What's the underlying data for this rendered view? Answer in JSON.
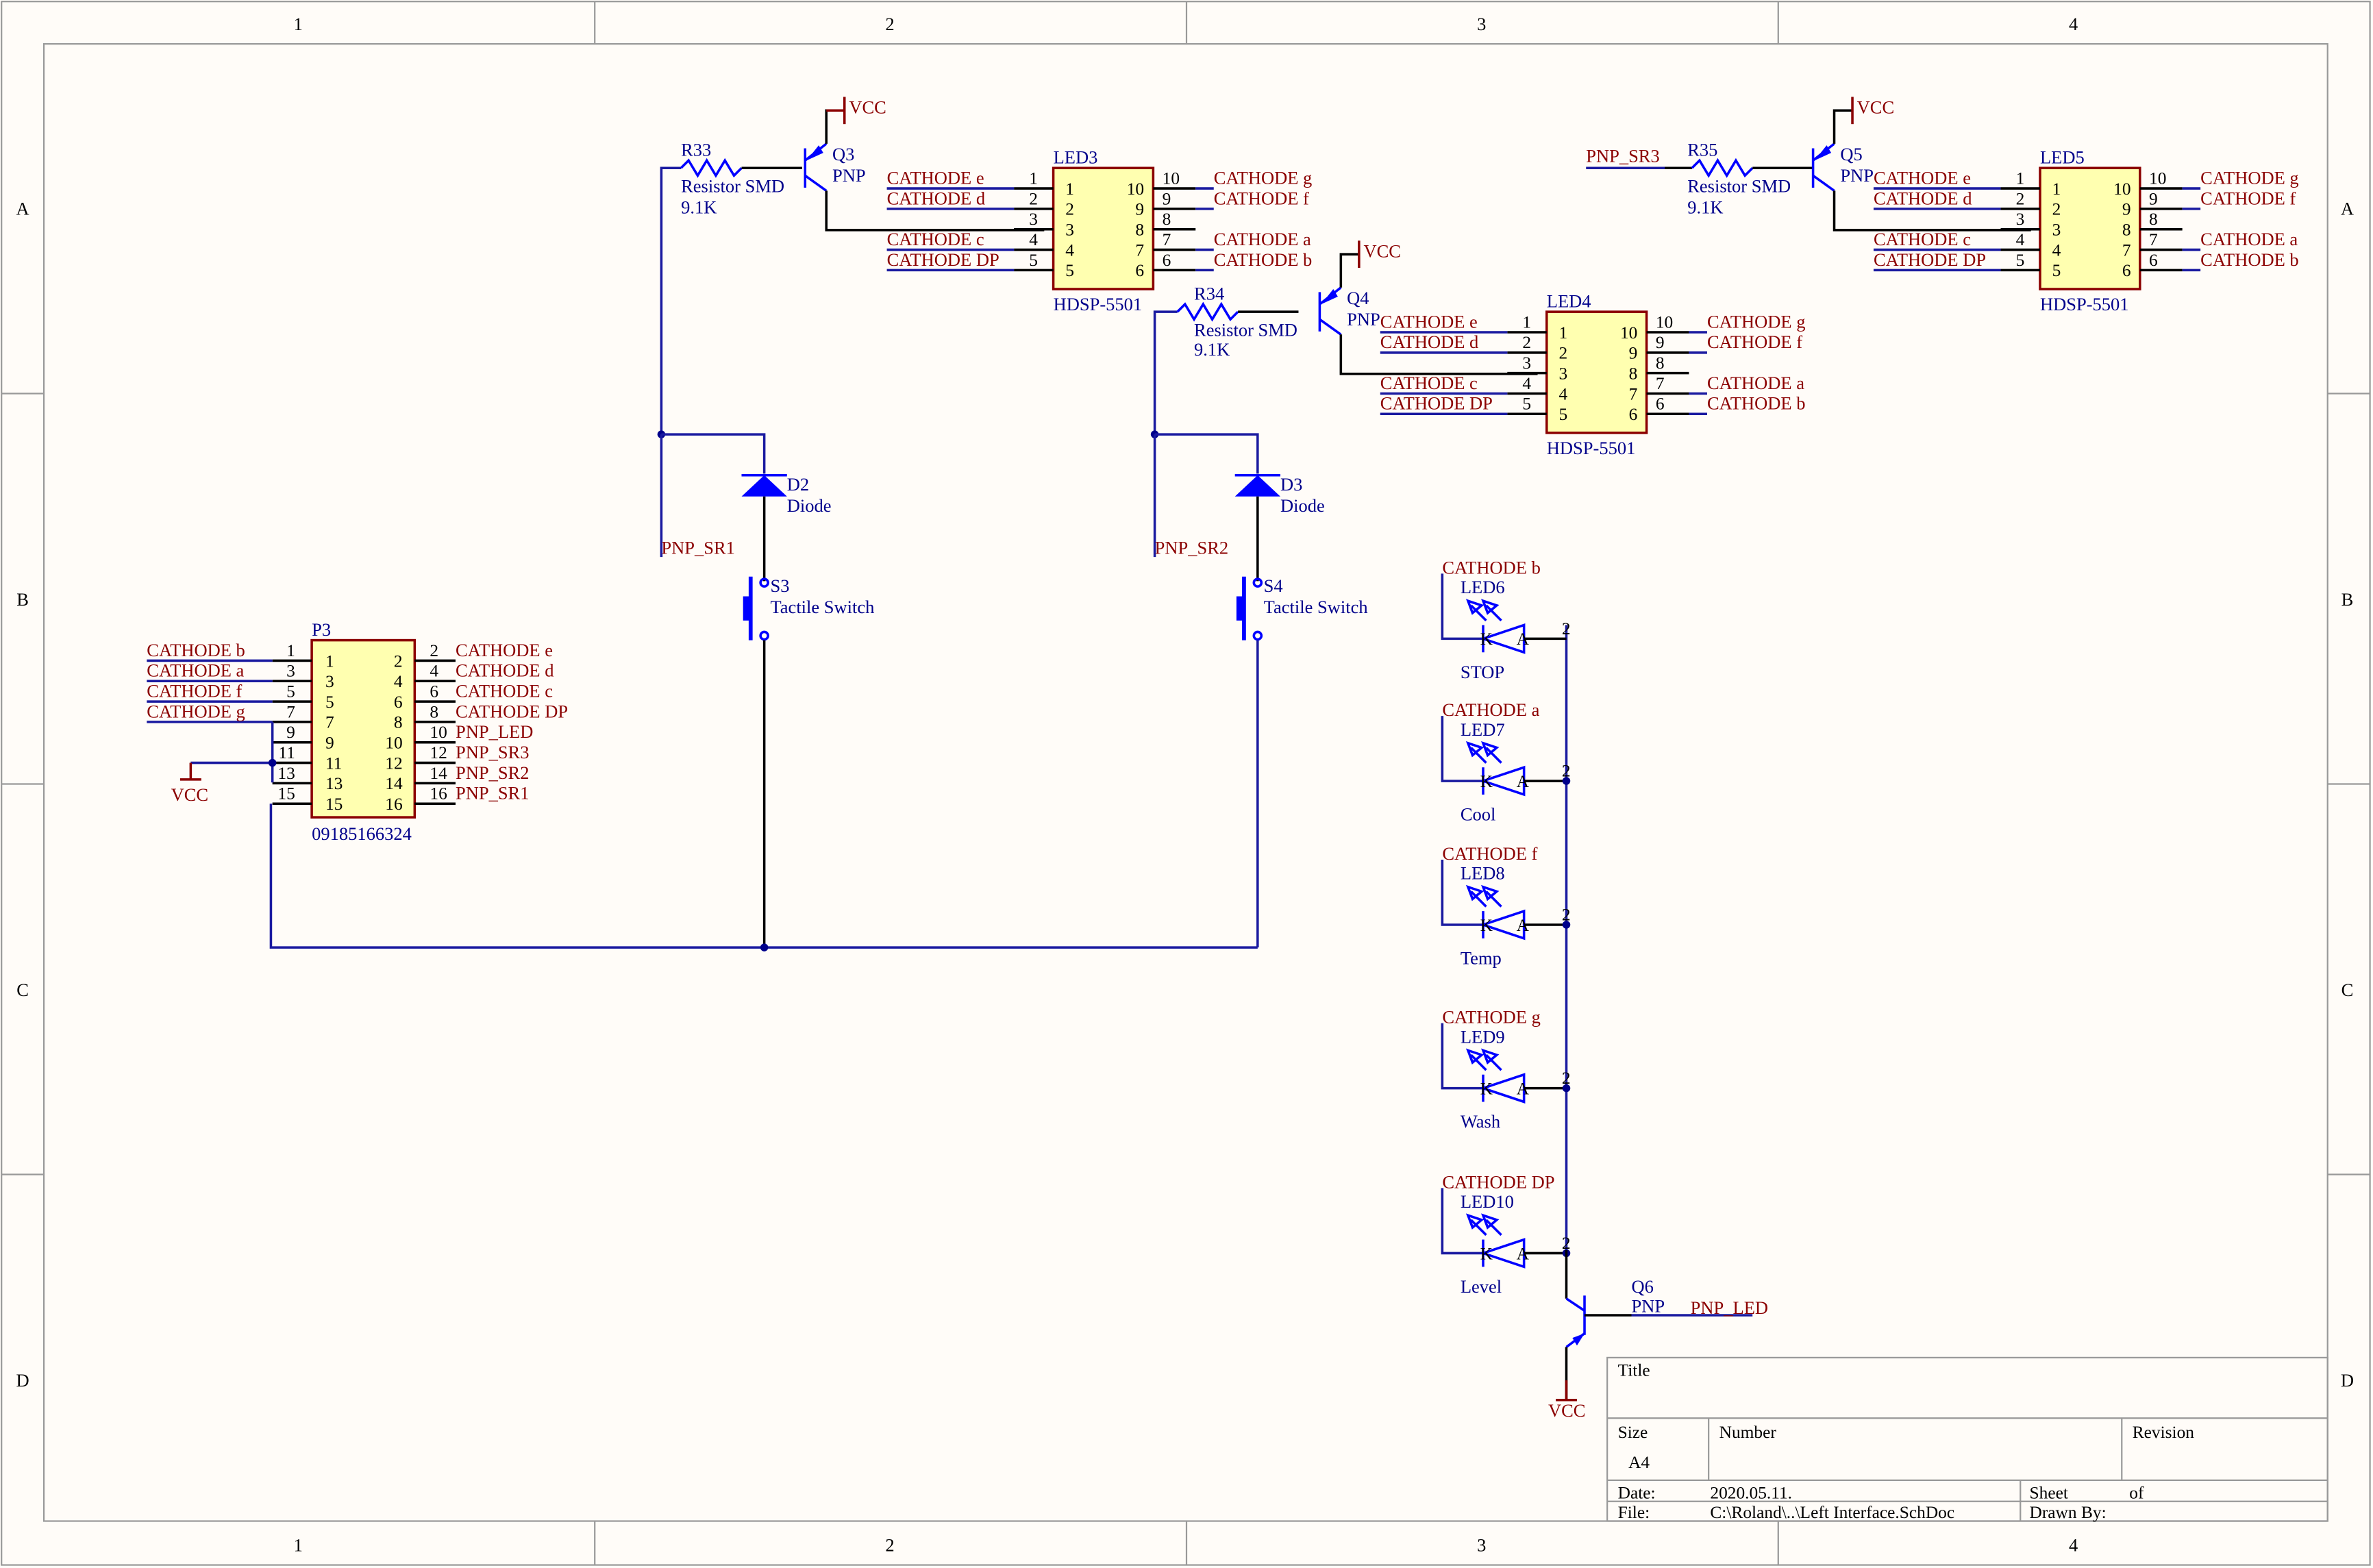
{
  "frame": {
    "columns": [
      "1",
      "2",
      "3",
      "4"
    ],
    "rows": [
      "A",
      "B",
      "C",
      "D"
    ]
  },
  "components": {
    "q3": {
      "ref": "Q3",
      "type": "PNP"
    },
    "q4": {
      "ref": "Q4",
      "type": "PNP"
    },
    "q5": {
      "ref": "Q5",
      "type": "PNP"
    },
    "q6": {
      "ref": "Q6",
      "type": "PNP"
    },
    "r33": {
      "ref": "R33",
      "type": "Resistor SMD",
      "value": "9.1K"
    },
    "r34": {
      "ref": "R34",
      "type": "Resistor SMD",
      "value": "9.1K"
    },
    "r35": {
      "ref": "R35",
      "type": "Resistor SMD",
      "value": "9.1K"
    },
    "d2": {
      "ref": "D2",
      "type": "Diode"
    },
    "d3": {
      "ref": "D3",
      "type": "Diode"
    },
    "s3": {
      "ref": "S3",
      "type": "Tactile Switch"
    },
    "s4": {
      "ref": "S4",
      "type": "Tactile Switch"
    },
    "led3": {
      "ref": "LED3",
      "part": "HDSP-5501"
    },
    "led4": {
      "ref": "LED4",
      "part": "HDSP-5501"
    },
    "led5": {
      "ref": "LED5",
      "part": "HDSP-5501"
    },
    "p3": {
      "ref": "P3",
      "part": "09185166324"
    },
    "indicators": [
      {
        "ref": "LED6",
        "net": "CATHODE b",
        "label": "STOP"
      },
      {
        "ref": "LED7",
        "net": "CATHODE a",
        "label": "Cool"
      },
      {
        "ref": "LED8",
        "net": "CATHODE f",
        "label": "Temp"
      },
      {
        "ref": "LED9",
        "net": "CATHODE g",
        "label": "Wash"
      },
      {
        "ref": "LED10",
        "net": "CATHODE DP",
        "label": "Level"
      }
    ]
  },
  "seg_display": {
    "left_pins": [
      {
        "num": "1",
        "net": "CATHODE e"
      },
      {
        "num": "2",
        "net": "CATHODE d"
      },
      {
        "num": "3",
        "net": ""
      },
      {
        "num": "4",
        "net": "CATHODE c"
      },
      {
        "num": "5",
        "net": "CATHODE DP"
      }
    ],
    "right_pins": [
      {
        "num": "10",
        "net": "CATHODE g"
      },
      {
        "num": "9",
        "net": "CATHODE f"
      },
      {
        "num": "8",
        "net": ""
      },
      {
        "num": "7",
        "net": "CATHODE a"
      },
      {
        "num": "6",
        "net": "CATHODE b"
      }
    ]
  },
  "p3_pins": {
    "left": [
      {
        "num": "1",
        "net": "CATHODE b"
      },
      {
        "num": "3",
        "net": "CATHODE a"
      },
      {
        "num": "5",
        "net": "CATHODE f"
      },
      {
        "num": "7",
        "net": "CATHODE g"
      },
      {
        "num": "9",
        "net": ""
      },
      {
        "num": "11",
        "net": ""
      },
      {
        "num": "13",
        "net": ""
      },
      {
        "num": "15",
        "net": ""
      }
    ],
    "right": [
      {
        "num": "2",
        "net": "CATHODE e"
      },
      {
        "num": "4",
        "net": "CATHODE d"
      },
      {
        "num": "6",
        "net": "CATHODE c"
      },
      {
        "num": "8",
        "net": "CATHODE DP"
      },
      {
        "num": "10",
        "net": "PNP_LED"
      },
      {
        "num": "12",
        "net": "PNP_SR3"
      },
      {
        "num": "14",
        "net": "PNP_SR2"
      },
      {
        "num": "16",
        "net": "PNP_SR1"
      }
    ]
  },
  "nets": {
    "vcc": "VCC",
    "pnp_sr1": "PNP_SR1",
    "pnp_sr2": "PNP_SR2",
    "pnp_sr3": "PNP_SR3",
    "pnp_led": "PNP_LED"
  },
  "pin_labels": {
    "k": "K",
    "a": "A",
    "one": "1",
    "two": "2"
  },
  "title_block": {
    "title_label": "Title",
    "size_label": "Size",
    "size_value": "A4",
    "number_label": "Number",
    "revision_label": "Revision",
    "date_label": "Date:",
    "date_value": "2020.05.11.",
    "sheet_label": "Sheet",
    "of_label": "of",
    "file_label": "File:",
    "file_value": "C:\\Roland\\..\\Left Interface.SchDoc",
    "drawn_by_label": "Drawn By:"
  }
}
